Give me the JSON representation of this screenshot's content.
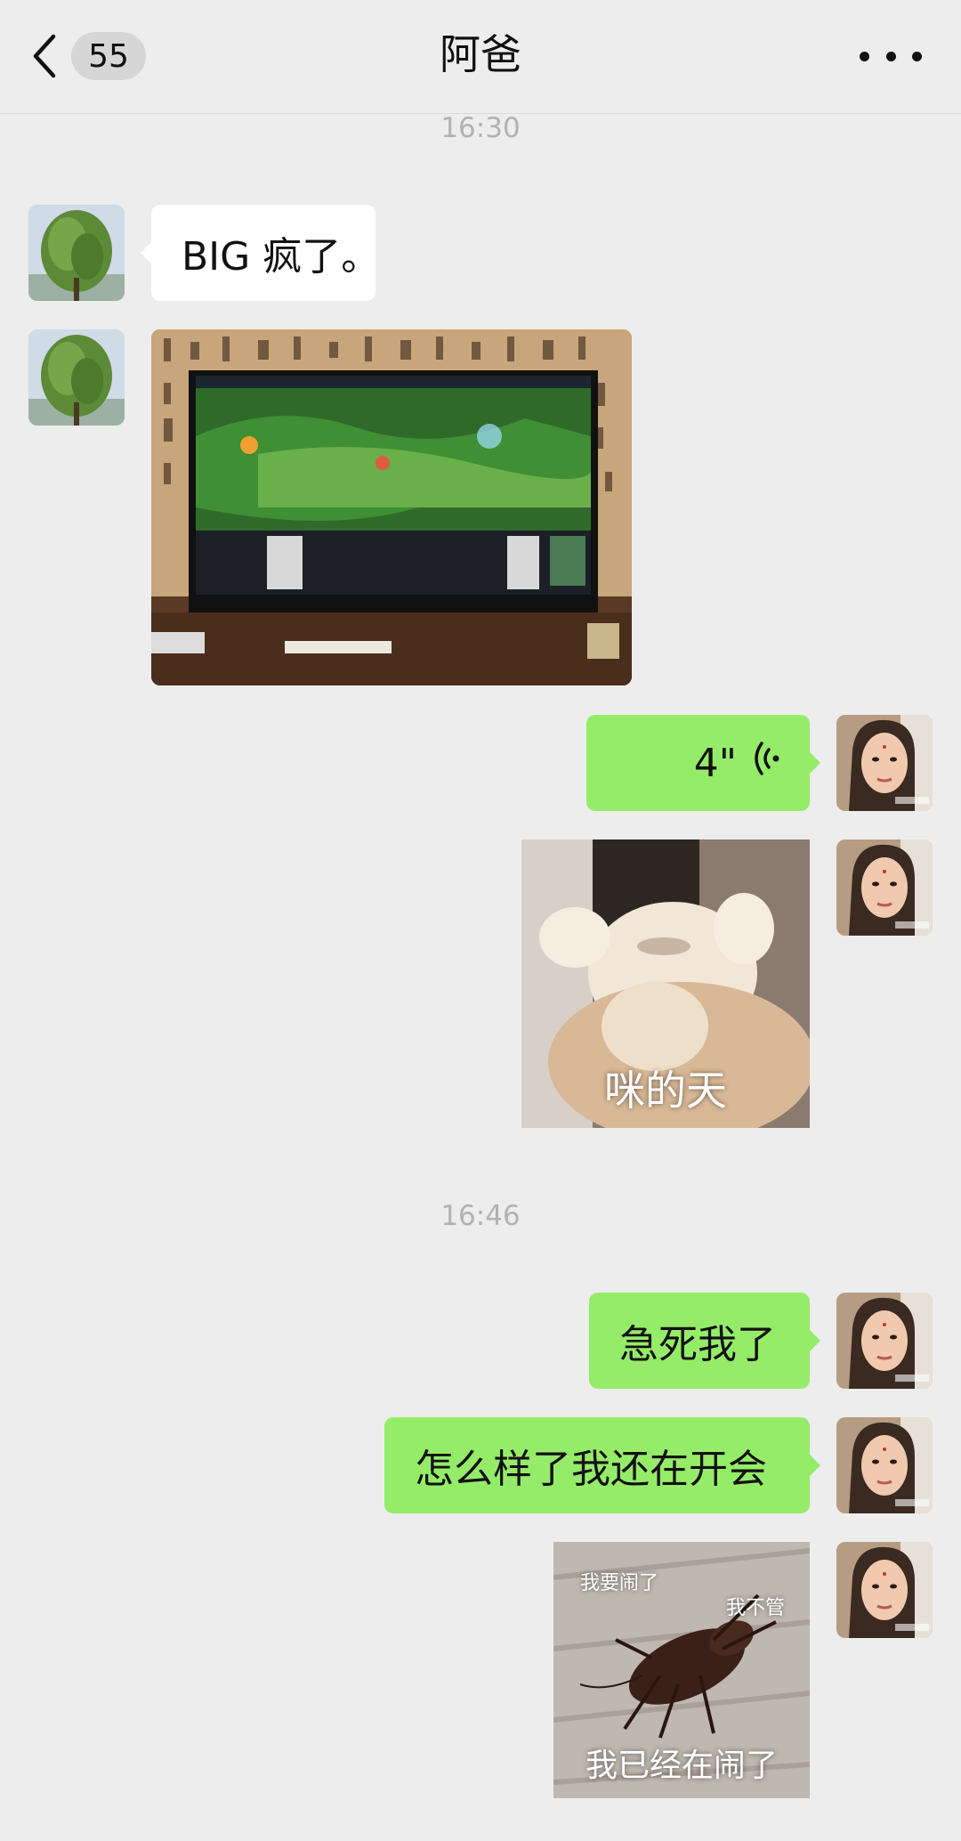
{
  "header": {
    "unread_count": "55",
    "title": "阿爸"
  },
  "timestamps": [
    "16:30",
    "16:46"
  ],
  "messages": [
    {
      "side": "left",
      "type": "text",
      "text": "BIG 疯了。"
    },
    {
      "side": "left",
      "type": "image"
    },
    {
      "side": "right",
      "type": "voice",
      "duration": "4\""
    },
    {
      "side": "right",
      "type": "sticker",
      "caption": "咪的天"
    },
    {
      "side": "right",
      "type": "text",
      "text": "急死我了"
    },
    {
      "side": "right",
      "type": "text",
      "text": "怎么样了我还在开会"
    },
    {
      "side": "right",
      "type": "sticker",
      "caption": "我已经在闹了",
      "sub_captions": [
        "我要闹了",
        "我不管"
      ]
    }
  ],
  "colors": {
    "background": "#ededed",
    "bubble_sent": "#95ec69",
    "bubble_received": "#ffffff",
    "timestamp": "#b2b2b2"
  },
  "icons": {
    "back": "chevron-left-icon",
    "more": "more-dots-icon",
    "voice": "voice-wave-icon"
  }
}
